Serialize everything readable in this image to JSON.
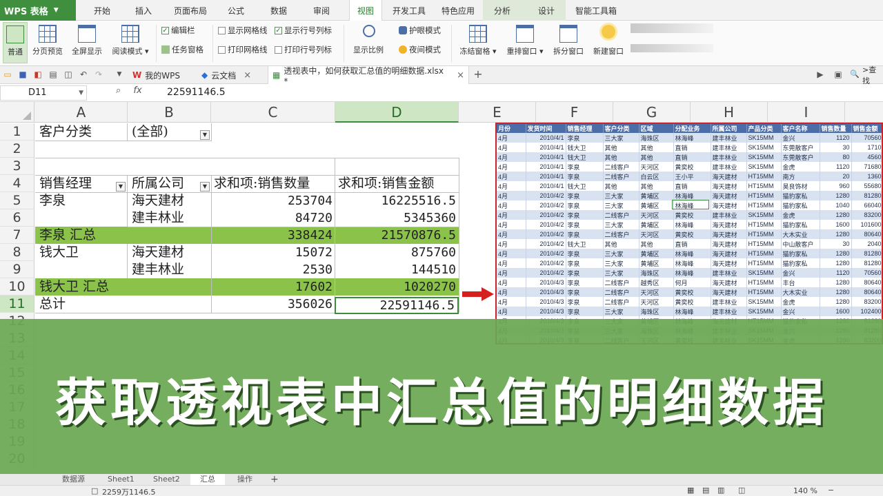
{
  "app": {
    "logo": "WPS 表格"
  },
  "menu": [
    "开始",
    "插入",
    "页面布局",
    "公式",
    "数据",
    "审阅",
    "视图",
    "开发工具",
    "特色应用",
    "分析",
    "设计",
    "智能工具箱"
  ],
  "ribbon": {
    "normal": "普通",
    "page_break": "分页预览",
    "fullscreen": "全屏显示",
    "reading": "阅读模式 ▾",
    "edit_bar": "编辑栏",
    "task_pane": "任务窗格",
    "show_grid": "显示网格线",
    "print_grid": "打印网格线",
    "show_rowcol": "显示行号列标",
    "print_rowcol": "打印行号列标",
    "zoom": "显示比例",
    "eye_mode": "护眼模式",
    "night_mode": "夜间模式",
    "freeze": "冻结窗格 ▾",
    "arrange": "重排窗口 ▾",
    "split": "拆分窗口",
    "new_window": "新建窗口"
  },
  "tabs": {
    "my_wps": "我的WPS",
    "cloud": "云文档",
    "file": "透视表中，如何获取汇总值的明细数据.xlsx *",
    "search": ">查找"
  },
  "formula": {
    "cell_ref": "D11",
    "value": "22591146.5"
  },
  "columns": [
    "A",
    "B",
    "C",
    "D",
    "E",
    "F",
    "G",
    "H",
    "I"
  ],
  "rows": [
    "1",
    "2",
    "3",
    "4",
    "5",
    "6",
    "7",
    "8",
    "9",
    "10",
    "11",
    "12",
    "13",
    "14",
    "15",
    "16",
    "17",
    "18",
    "19",
    "20"
  ],
  "pivot": {
    "filter_label": "客户分类",
    "filter_value": "(全部)",
    "h_manager": "销售经理",
    "h_company": "所属公司",
    "h_qty": "求和项:销售数量",
    "h_amt": "求和项:销售金额",
    "r5": [
      "李泉",
      "海天建材",
      "253704",
      "16225516.5"
    ],
    "r6": [
      "",
      "建丰林业",
      "84720",
      "5345360"
    ],
    "r7": [
      "李泉 汇总",
      "",
      "338424",
      "21570876.5"
    ],
    "r8": [
      "钱大卫",
      "海天建材",
      "15072",
      "875760"
    ],
    "r9": [
      "",
      "建丰林业",
      "2530",
      "144510"
    ],
    "r10": [
      "钱大卫 汇总",
      "",
      "17602",
      "1020270"
    ],
    "r11": [
      "总计",
      "",
      "356026",
      "22591146.5"
    ]
  },
  "detail": {
    "headers": [
      "月份",
      "发货时间",
      "销售经理",
      "客户分类",
      "区域",
      "分配业务",
      "所属公司",
      "产品分类",
      "客户名称",
      "销售数量",
      "销售金额"
    ],
    "rows": [
      [
        "4月",
        "2010/4/1",
        "李泉",
        "三大家",
        "海珠区",
        "林海峰",
        "建丰林业",
        "SK15MM",
        "金兴",
        "1120",
        "70560"
      ],
      [
        "4月",
        "2010/4/1",
        "钱大卫",
        "其他",
        "其他",
        "直销",
        "建丰林业",
        "SK15MM",
        "东莞散客户",
        "30",
        "1710"
      ],
      [
        "4月",
        "2010/4/1",
        "钱大卫",
        "其他",
        "其他",
        "直销",
        "建丰林业",
        "SK15MM",
        "东莞散客户",
        "80",
        "4560"
      ],
      [
        "4月",
        "2010/4/1",
        "李泉",
        "二线客户",
        "天河区",
        "黄奕校",
        "建丰林业",
        "SK15MM",
        "金虎",
        "1120",
        "71680"
      ],
      [
        "4月",
        "2010/4/1",
        "李泉",
        "二线客户",
        "白云区",
        "王小平",
        "海天建材",
        "HT15MM",
        "南方",
        "20",
        "1360"
      ],
      [
        "4月",
        "2010/4/1",
        "钱大卫",
        "其他",
        "其他",
        "直销",
        "海天建材",
        "HT15MM",
        "昊良饰材",
        "960",
        "55680"
      ],
      [
        "4月",
        "2010/4/2",
        "李泉",
        "三大家",
        "黄埔区",
        "林海峰",
        "海天建材",
        "HT15MM",
        "猫豹家私",
        "1280",
        "81280"
      ],
      [
        "4月",
        "2010/4/2",
        "李泉",
        "三大家",
        "黄埔区",
        "林海峰",
        "海天建材",
        "HT15MM",
        "猫豹家私",
        "1040",
        "66040"
      ],
      [
        "4月",
        "2010/4/2",
        "李泉",
        "二线客户",
        "天河区",
        "黄奕校",
        "建丰林业",
        "SK15MM",
        "金虎",
        "1280",
        "83200"
      ],
      [
        "4月",
        "2010/4/2",
        "李泉",
        "三大家",
        "黄埔区",
        "林海峰",
        "海天建材",
        "HT15MM",
        "猫豹家私",
        "1600",
        "101600"
      ],
      [
        "4月",
        "2010/4/2",
        "李泉",
        "二线客户",
        "天河区",
        "黄奕校",
        "海天建材",
        "HT15MM",
        "大木实业",
        "1280",
        "80640"
      ],
      [
        "4月",
        "2010/4/2",
        "钱大卫",
        "其他",
        "其他",
        "直销",
        "海天建材",
        "HT15MM",
        "中山散客户",
        "30",
        "2040"
      ],
      [
        "4月",
        "2010/4/2",
        "李泉",
        "三大家",
        "黄埔区",
        "林海峰",
        "海天建材",
        "HT15MM",
        "猫豹家私",
        "1280",
        "81280"
      ],
      [
        "4月",
        "2010/4/2",
        "李泉",
        "三大家",
        "黄埔区",
        "林海峰",
        "海天建材",
        "HT15MM",
        "猫豹家私",
        "1280",
        "81280"
      ],
      [
        "4月",
        "2010/4/2",
        "李泉",
        "三大家",
        "海珠区",
        "林海峰",
        "建丰林业",
        "SK15MM",
        "金兴",
        "1120",
        "70560"
      ],
      [
        "4月",
        "2010/4/3",
        "李泉",
        "二线客户",
        "越秀区",
        "何月",
        "海天建材",
        "HT15MM",
        "丰台",
        "1280",
        "80640"
      ],
      [
        "4月",
        "2010/4/3",
        "李泉",
        "二线客户",
        "天河区",
        "黄奕校",
        "海天建材",
        "HT15MM",
        "大木实业",
        "1280",
        "80640"
      ],
      [
        "4月",
        "2010/4/3",
        "李泉",
        "二线客户",
        "天河区",
        "黄奕校",
        "建丰林业",
        "SK15MM",
        "金虎",
        "1280",
        "83200"
      ],
      [
        "4月",
        "2010/4/3",
        "李泉",
        "三大家",
        "海珠区",
        "林海峰",
        "建丰林业",
        "SK15MM",
        "金兴",
        "1600",
        "102400"
      ],
      [
        "4月",
        "2010/4/3",
        "李泉",
        "三大家",
        "黄埔区",
        "林海峰",
        "海天建材",
        "HT15MM",
        "猫豹家私",
        "1280",
        "81280"
      ],
      [
        "4月",
        "2010/4/3",
        "李泉",
        "三大家",
        "海珠区",
        "林海峰",
        "建丰林业",
        "SK15MM",
        "金兴",
        "1280",
        "81280"
      ],
      [
        "4月",
        "2010/4/3",
        "李泉",
        "二线客户",
        "天河区",
        "黄奕校",
        "建丰林业",
        "SK15MM",
        "金虎",
        "1280",
        "83200"
      ]
    ]
  },
  "banner": "获取透视表中汇总值的明细数据",
  "sheet_tabs": [
    "数据源",
    "Sheet1",
    "Sheet2",
    "汇总",
    "操作",
    "+"
  ],
  "status": {
    "sum": "2259万1146.5",
    "zoom": "140 %"
  },
  "colors": {
    "brand_green": "#3f8f3f",
    "subtotal_band": "#8bc34a",
    "banner": "#6ca854",
    "highlight_border": "#c8252a",
    "detail_header": "#4c6ea8"
  }
}
